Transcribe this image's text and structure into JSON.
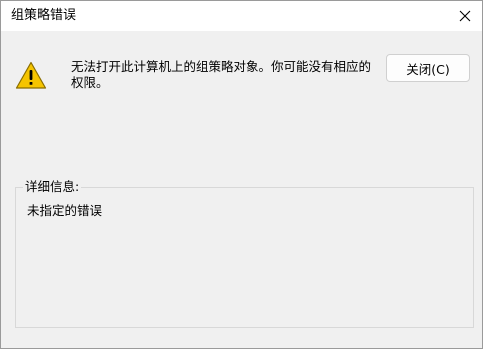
{
  "window": {
    "title": "组策略错误",
    "close_icon": "close-icon"
  },
  "dialog": {
    "icon": "warning-icon",
    "message": "无法打开此计算机上的组策略对象。你可能没有相应的权限。",
    "close_button_label": "关闭(C)"
  },
  "details": {
    "label": "详细信息:",
    "text": "未指定的错误"
  },
  "colors": {
    "warning_fill": "#f5c400",
    "warning_outline": "#8a6d00",
    "dialog_bg": "#f0f0f0",
    "titlebar_bg": "#ffffff"
  }
}
